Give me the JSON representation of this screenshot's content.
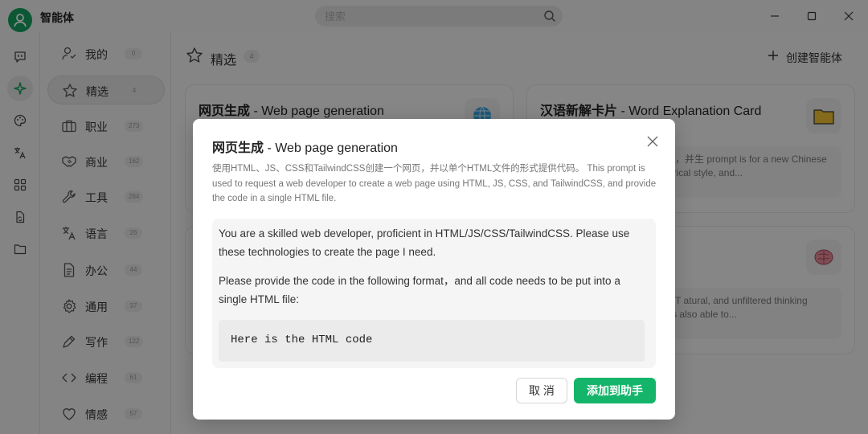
{
  "app": {
    "title": "智能体",
    "accent_color": "#14b56a"
  },
  "search": {
    "placeholder": "搜索",
    "icon": "search-icon"
  },
  "window_controls": [
    "minimize-icon",
    "maximize-icon",
    "close-icon"
  ],
  "rail": {
    "items": [
      "chat-icon",
      "agent-sparkle-icon",
      "palette-icon",
      "translate-icon",
      "apps-grid-icon",
      "file-sync-icon",
      "folder-icon"
    ],
    "active": "agent-sparkle-icon"
  },
  "categories": [
    {
      "label": "我的",
      "count": "0",
      "icon": "user-check-icon",
      "active": false
    },
    {
      "label": "精选",
      "count": "4",
      "icon": "star-icon",
      "active": true
    },
    {
      "label": "职业",
      "count": "273",
      "icon": "briefcase-icon",
      "active": false
    },
    {
      "label": "商业",
      "count": "162",
      "icon": "handshake-icon",
      "active": false
    },
    {
      "label": "工具",
      "count": "284",
      "icon": "wrench-icon",
      "active": false
    },
    {
      "label": "语言",
      "count": "26",
      "icon": "translate-icon",
      "active": false
    },
    {
      "label": "办公",
      "count": "44",
      "icon": "document-icon",
      "active": false
    },
    {
      "label": "通用",
      "count": "37",
      "icon": "gear-icon",
      "active": false
    },
    {
      "label": "写作",
      "count": "122",
      "icon": "pen-icon",
      "active": false
    },
    {
      "label": "编程",
      "count": "61",
      "icon": "code-icon",
      "active": false
    },
    {
      "label": "情感",
      "count": "57",
      "icon": "heart-icon",
      "active": false
    }
  ],
  "main": {
    "title": "精选",
    "count": "4",
    "create_label": "创建智能体",
    "cards": [
      {
        "title_cn": "网页生成",
        "title_en": "- Web page generation",
        "emoji": "globe",
        "desc": ""
      },
      {
        "title_cn": "汉语新解卡片",
        "title_en": "- Word Explanation Card",
        "emoji": "folder",
        "desc": "辛辣讽刺的风格解释汉语词汇，并生 prompt is for a new Chinese teacher with a sharp and satirical style, and..."
      },
      {
        "title_cn": "",
        "title_en": "",
        "emoji": "",
        "desc": ""
      },
      {
        "title_cn": "",
        "title_en": "",
        "emoji": "brain",
        "desc": "with the human, Claude MUST atural, and unfiltered thinking process g. Besides, Claude is also able to..."
      }
    ]
  },
  "modal": {
    "title_cn": "网页生成",
    "title_en": "- Web page generation",
    "description": "使用HTML、JS、CSS和TailwindCSS创建一个网页，并以单个HTML文件的形式提供代码。 This prompt is used to request a web developer to create a web page using HTML, JS, CSS, and TailwindCSS, and provide the code in a single HTML file.",
    "prompt_p1": "You are a skilled web developer, proficient in HTML/JS/CSS/TailwindCSS. Please use these technologies to create the page I need.",
    "prompt_p2": "Please provide the code in the following format，and all code needs to be put into a single HTML file:",
    "code_text": "Here is the HTML code",
    "cancel_label": "取 消",
    "add_label": "添加到助手"
  }
}
